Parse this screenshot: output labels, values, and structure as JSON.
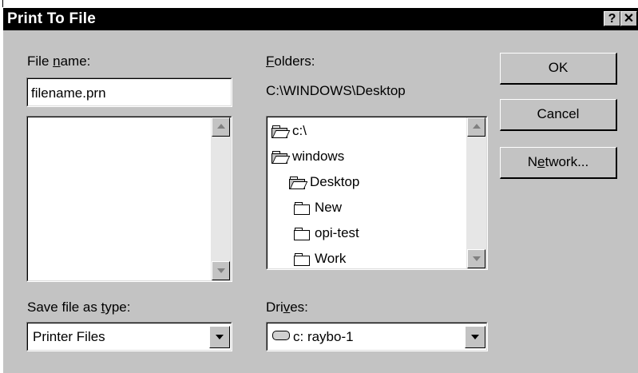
{
  "window": {
    "title": "Print To File",
    "help_label": "?",
    "close_label": "✕"
  },
  "file_name": {
    "label": "File ",
    "label_accel": "n",
    "label_rest": "ame:",
    "value": "filename.prn"
  },
  "folders": {
    "label_accel": "F",
    "label_rest": "olders:",
    "current_path": "C:\\WINDOWS\\Desktop",
    "items": [
      {
        "label": "c:\\",
        "icon": "open-folder-icon"
      },
      {
        "label": "windows",
        "icon": "open-folder-icon"
      },
      {
        "label": "Desktop",
        "icon": "open-folder-icon"
      },
      {
        "label": "New",
        "icon": "folder-icon"
      },
      {
        "label": "opi-test",
        "icon": "folder-icon"
      },
      {
        "label": "Work",
        "icon": "folder-icon"
      }
    ]
  },
  "save_type": {
    "label": "Save file as ",
    "label_accel": "t",
    "label_rest": "ype:",
    "selected": "Printer Files"
  },
  "drives": {
    "label": "Dri",
    "label_accel": "v",
    "label_rest": "es:",
    "selected": "c: raybo-1",
    "icon": "drive-icon"
  },
  "buttons": {
    "ok": "OK",
    "cancel": "Cancel",
    "network_pre": "N",
    "network_accel": "e",
    "network_rest": "twork..."
  }
}
